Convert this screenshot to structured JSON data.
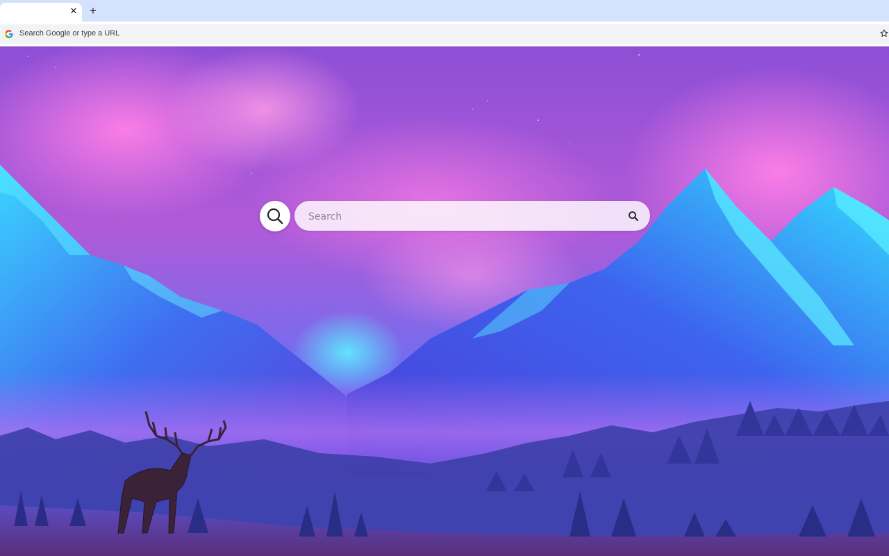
{
  "tabs": [
    {
      "title": "",
      "close_glyph": "✕"
    }
  ],
  "new_tab_glyph": "+",
  "omnibox": {
    "placeholder": "Search Google or type a URL",
    "icon": "google-g-icon",
    "bookmark_icon": "star-outline-icon"
  },
  "page": {
    "search": {
      "placeholder": "Search",
      "left_icon": "magnifier-icon",
      "right_icon": "search-icon"
    },
    "background": {
      "description_icons": [
        "mountains",
        "aurora",
        "deer",
        "pine-forest"
      ]
    }
  },
  "colors": {
    "tabstrip": "#d3e3fd",
    "sky_top": "#9a55d8",
    "aurora_pink": "#ff7be0",
    "mountain_blue": "#2f4fe0",
    "mountain_cyan": "#2bd2f5",
    "forest": "#2b2f8a"
  }
}
